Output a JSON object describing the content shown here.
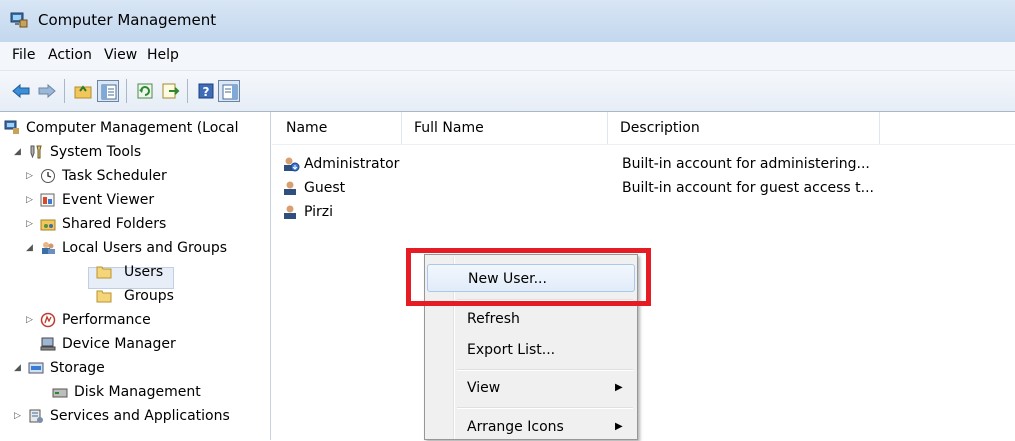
{
  "window": {
    "title": "Computer Management"
  },
  "menubar": {
    "items": [
      "File",
      "Action",
      "View",
      "Help"
    ]
  },
  "toolbar": {
    "buttons": [
      "back-arrow-icon",
      "forward-arrow-icon",
      "up-folder-icon",
      "show-hide-tree-icon",
      "refresh-icon",
      "export-list-icon",
      "help-icon",
      "show-hide-action-pane-icon"
    ]
  },
  "tree": {
    "root": "Computer Management (Local",
    "items": [
      {
        "label": "System Tools",
        "icon": "tools-icon"
      },
      {
        "label": "Task Scheduler",
        "icon": "clock-icon"
      },
      {
        "label": "Event Viewer",
        "icon": "event-viewer-icon"
      },
      {
        "label": "Shared Folders",
        "icon": "shared-folder-icon"
      },
      {
        "label": "Local Users and Groups",
        "icon": "users-group-icon"
      },
      {
        "label": "Users",
        "icon": "folder-icon"
      },
      {
        "label": "Groups",
        "icon": "folder-icon"
      },
      {
        "label": "Performance",
        "icon": "performance-icon"
      },
      {
        "label": "Device Manager",
        "icon": "device-manager-icon"
      },
      {
        "label": "Storage",
        "icon": "storage-icon"
      },
      {
        "label": "Disk Management",
        "icon": "disk-icon"
      },
      {
        "label": "Services and Applications",
        "icon": "services-icon"
      }
    ],
    "selected": "Users"
  },
  "list": {
    "columns": [
      "Name",
      "Full Name",
      "Description"
    ],
    "rows": [
      {
        "name": "Administrator",
        "full_name": "",
        "description": "Built-in account for administering..."
      },
      {
        "name": "Guest",
        "full_name": "",
        "description": "Built-in account for guest access t..."
      },
      {
        "name": "Pirzi",
        "full_name": "",
        "description": ""
      }
    ]
  },
  "context_menu": {
    "items": [
      {
        "label": "New User...",
        "submenu": false,
        "highlighted": true
      },
      {
        "label": "Refresh",
        "submenu": false
      },
      {
        "label": "Export List...",
        "submenu": false
      },
      {
        "label": "View",
        "submenu": true
      },
      {
        "label": "Arrange Icons",
        "submenu": true
      }
    ],
    "submenu_arrow": "▶"
  },
  "colors": {
    "highlight_box": "#e51c24",
    "titlebar": "#c3d7ee",
    "selection": "#e8eef7"
  }
}
